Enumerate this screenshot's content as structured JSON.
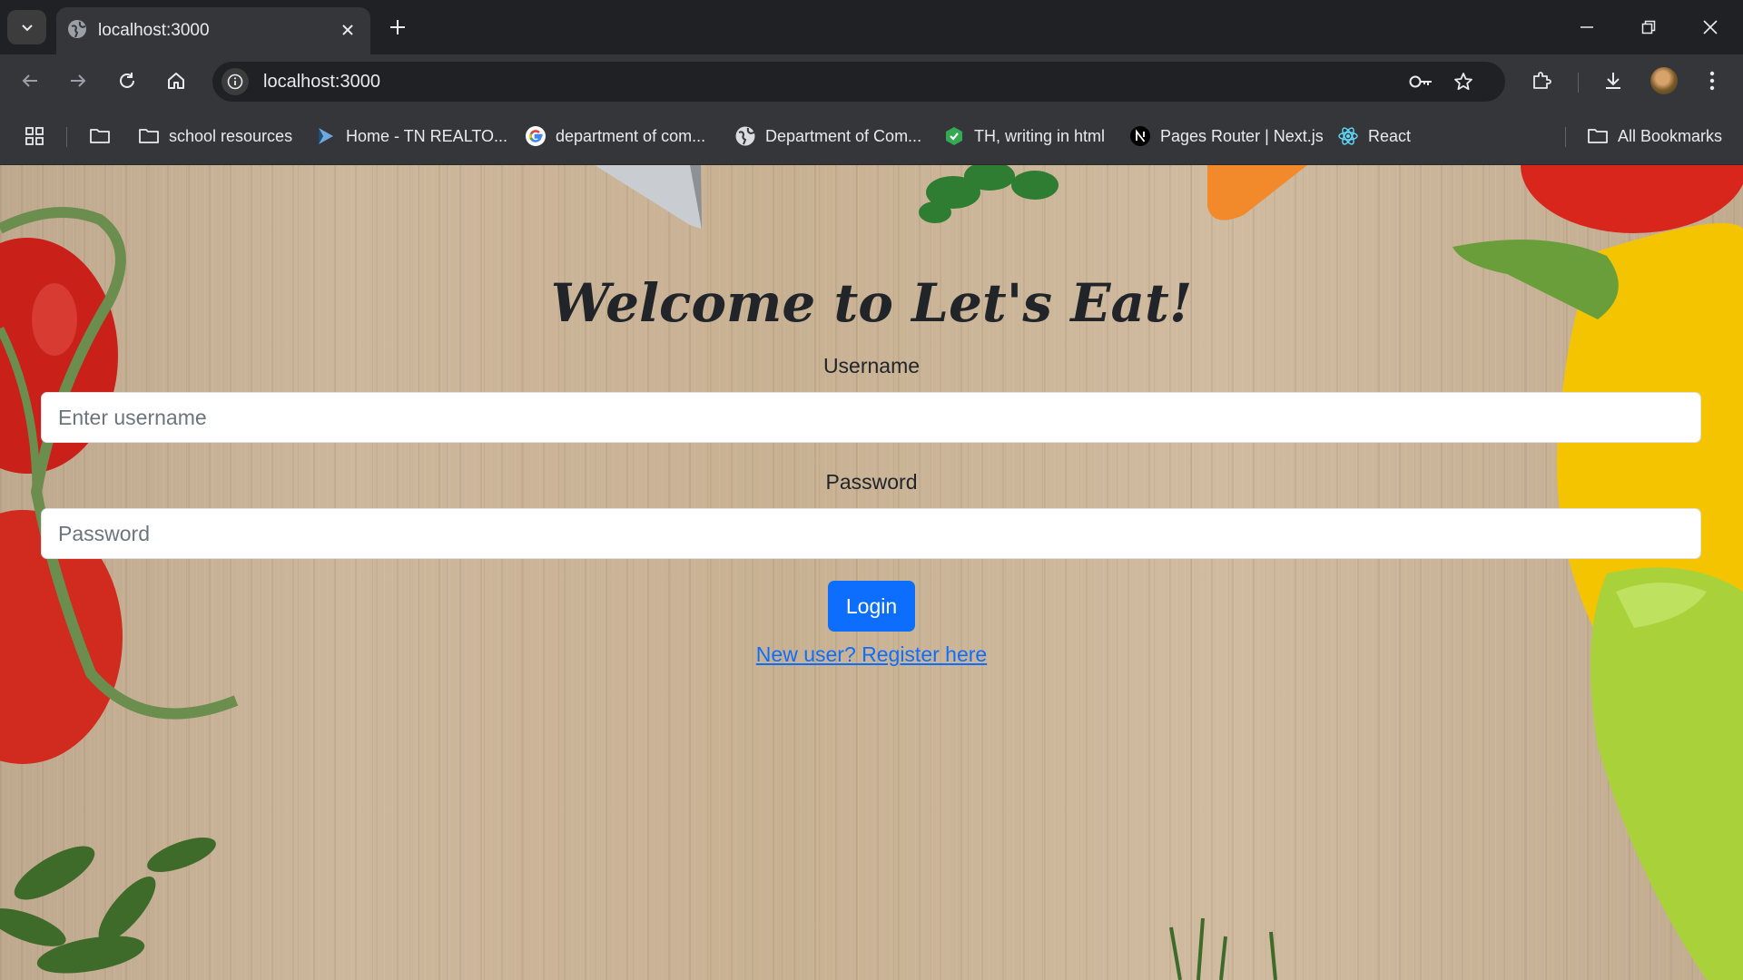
{
  "browser": {
    "tab": {
      "title": "localhost:3000"
    },
    "address_bar": {
      "url": "localhost:3000"
    },
    "bookmarks": [
      {
        "label": "school resources",
        "icon": "folder-icon"
      },
      {
        "label": "Home - TN REALTO...",
        "icon": "realtor-flag-icon"
      },
      {
        "label": "department of com...",
        "icon": "google-icon"
      },
      {
        "label": "Department of Com...",
        "icon": "globe-icon"
      },
      {
        "label": "TH, writing in html",
        "icon": "extension-icon"
      },
      {
        "label": "Pages Router | Next.js",
        "icon": "nextjs-icon"
      },
      {
        "label": "React",
        "icon": "react-icon"
      }
    ],
    "all_bookmarks_label": "All Bookmarks"
  },
  "page": {
    "heading": "Welcome to Let's Eat!",
    "username_label": "Username",
    "username_placeholder": "Enter username",
    "password_label": "Password",
    "password_placeholder": "Password",
    "login_label": "Login",
    "register_link": "New user? Register here"
  },
  "colors": {
    "primary_button": "#0d6efd",
    "link": "#0d6efd",
    "heading_text": "#212529",
    "browser_frame": "#202124",
    "browser_toolbar": "#35363a"
  }
}
